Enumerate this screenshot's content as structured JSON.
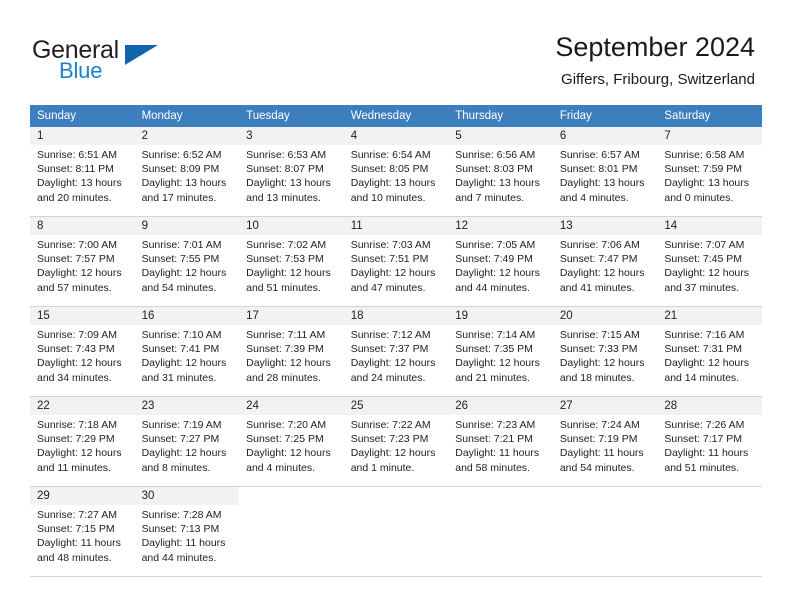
{
  "brand": {
    "name_part1": "General",
    "name_part2": "Blue",
    "triangle_color": "#1364ae",
    "blue_color": "#1b7fd4"
  },
  "header": {
    "title": "September 2024",
    "subtitle": "Giffers, Fribourg, Switzerland"
  },
  "theme": {
    "header_row_color": "#3d7ebe",
    "daynum_background": "#f2f2f2",
    "border_color": "#d4d4d4"
  },
  "calendar": {
    "weekday_headers": [
      "Sunday",
      "Monday",
      "Tuesday",
      "Wednesday",
      "Thursday",
      "Friday",
      "Saturday"
    ],
    "weeks": [
      [
        {
          "day": "1",
          "sunrise": "Sunrise: 6:51 AM",
          "sunset": "Sunset: 8:11 PM",
          "daylight_line1": "Daylight: 13 hours",
          "daylight_line2": "and 20 minutes."
        },
        {
          "day": "2",
          "sunrise": "Sunrise: 6:52 AM",
          "sunset": "Sunset: 8:09 PM",
          "daylight_line1": "Daylight: 13 hours",
          "daylight_line2": "and 17 minutes."
        },
        {
          "day": "3",
          "sunrise": "Sunrise: 6:53 AM",
          "sunset": "Sunset: 8:07 PM",
          "daylight_line1": "Daylight: 13 hours",
          "daylight_line2": "and 13 minutes."
        },
        {
          "day": "4",
          "sunrise": "Sunrise: 6:54 AM",
          "sunset": "Sunset: 8:05 PM",
          "daylight_line1": "Daylight: 13 hours",
          "daylight_line2": "and 10 minutes."
        },
        {
          "day": "5",
          "sunrise": "Sunrise: 6:56 AM",
          "sunset": "Sunset: 8:03 PM",
          "daylight_line1": "Daylight: 13 hours",
          "daylight_line2": "and 7 minutes."
        },
        {
          "day": "6",
          "sunrise": "Sunrise: 6:57 AM",
          "sunset": "Sunset: 8:01 PM",
          "daylight_line1": "Daylight: 13 hours",
          "daylight_line2": "and 4 minutes."
        },
        {
          "day": "7",
          "sunrise": "Sunrise: 6:58 AM",
          "sunset": "Sunset: 7:59 PM",
          "daylight_line1": "Daylight: 13 hours",
          "daylight_line2": "and 0 minutes."
        }
      ],
      [
        {
          "day": "8",
          "sunrise": "Sunrise: 7:00 AM",
          "sunset": "Sunset: 7:57 PM",
          "daylight_line1": "Daylight: 12 hours",
          "daylight_line2": "and 57 minutes."
        },
        {
          "day": "9",
          "sunrise": "Sunrise: 7:01 AM",
          "sunset": "Sunset: 7:55 PM",
          "daylight_line1": "Daylight: 12 hours",
          "daylight_line2": "and 54 minutes."
        },
        {
          "day": "10",
          "sunrise": "Sunrise: 7:02 AM",
          "sunset": "Sunset: 7:53 PM",
          "daylight_line1": "Daylight: 12 hours",
          "daylight_line2": "and 51 minutes."
        },
        {
          "day": "11",
          "sunrise": "Sunrise: 7:03 AM",
          "sunset": "Sunset: 7:51 PM",
          "daylight_line1": "Daylight: 12 hours",
          "daylight_line2": "and 47 minutes."
        },
        {
          "day": "12",
          "sunrise": "Sunrise: 7:05 AM",
          "sunset": "Sunset: 7:49 PM",
          "daylight_line1": "Daylight: 12 hours",
          "daylight_line2": "and 44 minutes."
        },
        {
          "day": "13",
          "sunrise": "Sunrise: 7:06 AM",
          "sunset": "Sunset: 7:47 PM",
          "daylight_line1": "Daylight: 12 hours",
          "daylight_line2": "and 41 minutes."
        },
        {
          "day": "14",
          "sunrise": "Sunrise: 7:07 AM",
          "sunset": "Sunset: 7:45 PM",
          "daylight_line1": "Daylight: 12 hours",
          "daylight_line2": "and 37 minutes."
        }
      ],
      [
        {
          "day": "15",
          "sunrise": "Sunrise: 7:09 AM",
          "sunset": "Sunset: 7:43 PM",
          "daylight_line1": "Daylight: 12 hours",
          "daylight_line2": "and 34 minutes."
        },
        {
          "day": "16",
          "sunrise": "Sunrise: 7:10 AM",
          "sunset": "Sunset: 7:41 PM",
          "daylight_line1": "Daylight: 12 hours",
          "daylight_line2": "and 31 minutes."
        },
        {
          "day": "17",
          "sunrise": "Sunrise: 7:11 AM",
          "sunset": "Sunset: 7:39 PM",
          "daylight_line1": "Daylight: 12 hours",
          "daylight_line2": "and 28 minutes."
        },
        {
          "day": "18",
          "sunrise": "Sunrise: 7:12 AM",
          "sunset": "Sunset: 7:37 PM",
          "daylight_line1": "Daylight: 12 hours",
          "daylight_line2": "and 24 minutes."
        },
        {
          "day": "19",
          "sunrise": "Sunrise: 7:14 AM",
          "sunset": "Sunset: 7:35 PM",
          "daylight_line1": "Daylight: 12 hours",
          "daylight_line2": "and 21 minutes."
        },
        {
          "day": "20",
          "sunrise": "Sunrise: 7:15 AM",
          "sunset": "Sunset: 7:33 PM",
          "daylight_line1": "Daylight: 12 hours",
          "daylight_line2": "and 18 minutes."
        },
        {
          "day": "21",
          "sunrise": "Sunrise: 7:16 AM",
          "sunset": "Sunset: 7:31 PM",
          "daylight_line1": "Daylight: 12 hours",
          "daylight_line2": "and 14 minutes."
        }
      ],
      [
        {
          "day": "22",
          "sunrise": "Sunrise: 7:18 AM",
          "sunset": "Sunset: 7:29 PM",
          "daylight_line1": "Daylight: 12 hours",
          "daylight_line2": "and 11 minutes."
        },
        {
          "day": "23",
          "sunrise": "Sunrise: 7:19 AM",
          "sunset": "Sunset: 7:27 PM",
          "daylight_line1": "Daylight: 12 hours",
          "daylight_line2": "and 8 minutes."
        },
        {
          "day": "24",
          "sunrise": "Sunrise: 7:20 AM",
          "sunset": "Sunset: 7:25 PM",
          "daylight_line1": "Daylight: 12 hours",
          "daylight_line2": "and 4 minutes."
        },
        {
          "day": "25",
          "sunrise": "Sunrise: 7:22 AM",
          "sunset": "Sunset: 7:23 PM",
          "daylight_line1": "Daylight: 12 hours",
          "daylight_line2": "and 1 minute."
        },
        {
          "day": "26",
          "sunrise": "Sunrise: 7:23 AM",
          "sunset": "Sunset: 7:21 PM",
          "daylight_line1": "Daylight: 11 hours",
          "daylight_line2": "and 58 minutes."
        },
        {
          "day": "27",
          "sunrise": "Sunrise: 7:24 AM",
          "sunset": "Sunset: 7:19 PM",
          "daylight_line1": "Daylight: 11 hours",
          "daylight_line2": "and 54 minutes."
        },
        {
          "day": "28",
          "sunrise": "Sunrise: 7:26 AM",
          "sunset": "Sunset: 7:17 PM",
          "daylight_line1": "Daylight: 11 hours",
          "daylight_line2": "and 51 minutes."
        }
      ],
      [
        {
          "day": "29",
          "sunrise": "Sunrise: 7:27 AM",
          "sunset": "Sunset: 7:15 PM",
          "daylight_line1": "Daylight: 11 hours",
          "daylight_line2": "and 48 minutes."
        },
        {
          "day": "30",
          "sunrise": "Sunrise: 7:28 AM",
          "sunset": "Sunset: 7:13 PM",
          "daylight_line1": "Daylight: 11 hours",
          "daylight_line2": "and 44 minutes."
        },
        {
          "day": "",
          "sunrise": "",
          "sunset": "",
          "daylight_line1": "",
          "daylight_line2": ""
        },
        {
          "day": "",
          "sunrise": "",
          "sunset": "",
          "daylight_line1": "",
          "daylight_line2": ""
        },
        {
          "day": "",
          "sunrise": "",
          "sunset": "",
          "daylight_line1": "",
          "daylight_line2": ""
        },
        {
          "day": "",
          "sunrise": "",
          "sunset": "",
          "daylight_line1": "",
          "daylight_line2": ""
        },
        {
          "day": "",
          "sunrise": "",
          "sunset": "",
          "daylight_line1": "",
          "daylight_line2": ""
        }
      ]
    ]
  }
}
